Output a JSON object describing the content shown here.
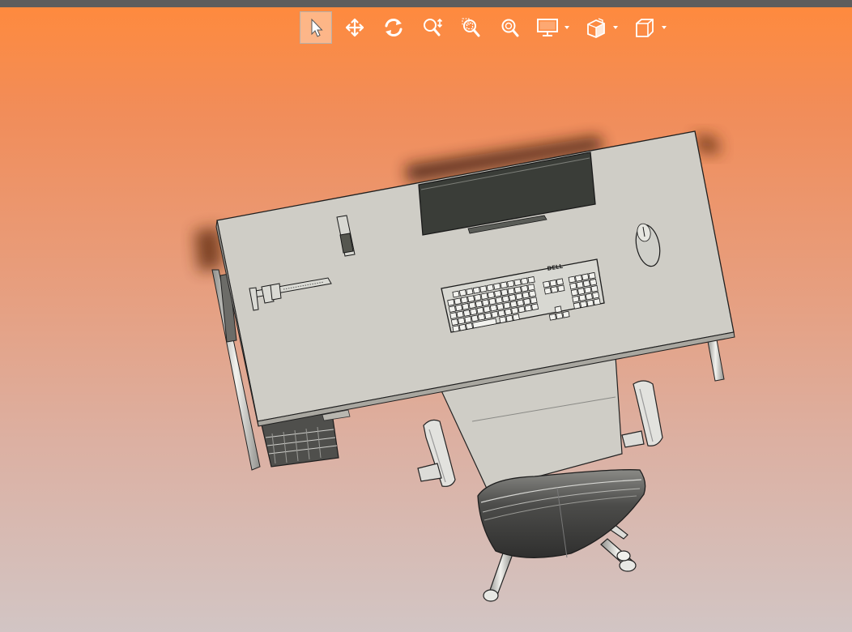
{
  "window": {
    "title_bar": ""
  },
  "toolbar": {
    "tools": [
      {
        "name": "select-tool",
        "icon": "arrow-pointer-icon",
        "active": true
      },
      {
        "name": "pan-tool",
        "icon": "move-arrows-icon",
        "active": false
      },
      {
        "name": "rotate-tool",
        "icon": "rotate-icon",
        "active": false
      },
      {
        "name": "zoom-in-out-tool",
        "icon": "zoom-in-out-icon",
        "active": false
      },
      {
        "name": "zoom-to-area-tool",
        "icon": "zoom-area-icon",
        "active": false
      },
      {
        "name": "zoom-to-fit-tool",
        "icon": "zoom-fit-icon",
        "active": false
      },
      {
        "name": "display-style-tool",
        "icon": "monitor-icon",
        "has_dropdown": true
      },
      {
        "name": "view-orientation-tool",
        "icon": "section-box-icon",
        "has_dropdown": true
      },
      {
        "name": "standard-views-tool",
        "icon": "cube-icon",
        "has_dropdown": true
      }
    ],
    "accent_color": "#ffffff"
  },
  "scene": {
    "background_top": "#ff8a3c",
    "background_bottom": "#d2c5c4",
    "model": {
      "desk_color": "#cfcdc6",
      "edge_color": "#2a2a2a",
      "monitor_color": "#3a3d38",
      "keyboard_brand": "DELL",
      "chair_color": "#4a4a48",
      "parts": [
        "desk",
        "monitor",
        "keyboard",
        "mouse",
        "usb-drive",
        "caliper",
        "pc-tower",
        "office-chair"
      ]
    }
  }
}
